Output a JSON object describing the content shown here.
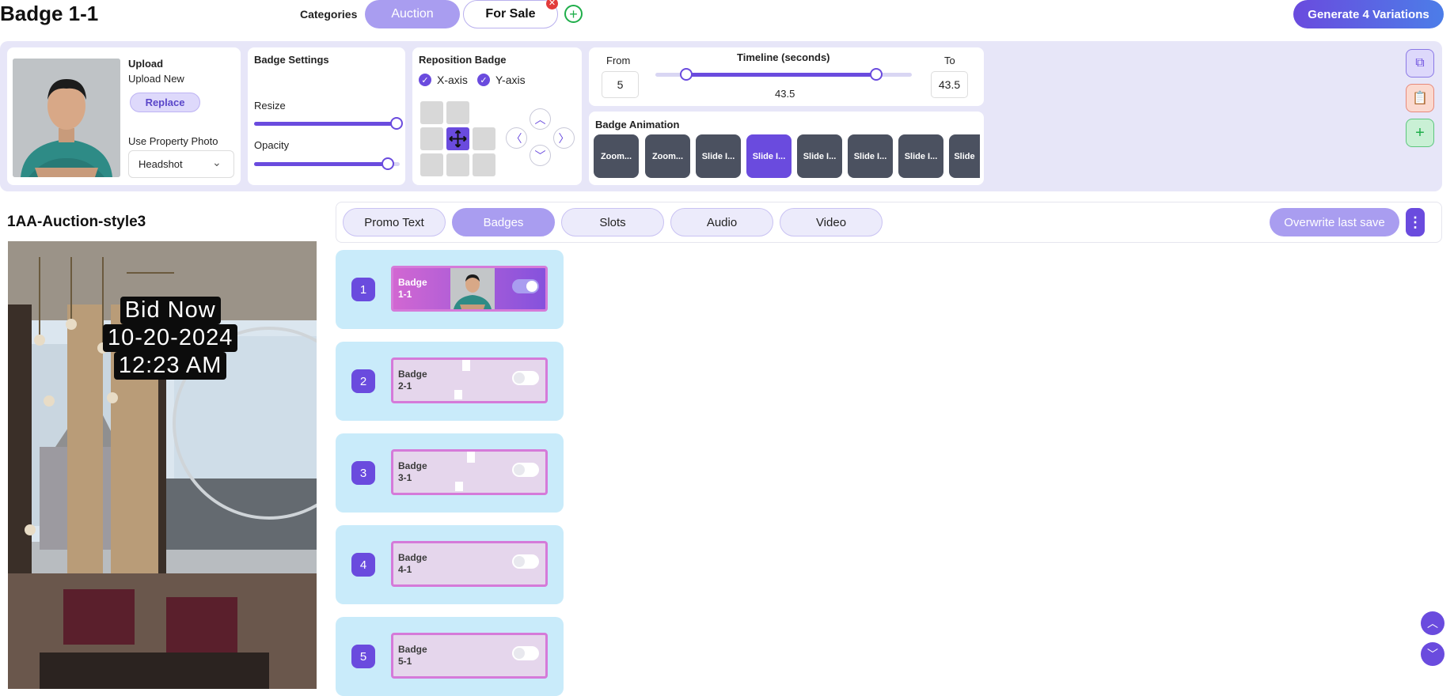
{
  "header": {
    "title": "Badge 1-1",
    "categories_label": "Categories",
    "tabs": [
      {
        "label": "Auction",
        "active": true
      },
      {
        "label": "For Sale",
        "active": false
      }
    ],
    "generate_label": "Generate 4 Variations"
  },
  "upload": {
    "heading": "Upload",
    "subheading": "Upload New",
    "replace_label": "Replace",
    "property_photo_label": "Use Property Photo",
    "property_photo_value": "Headshot"
  },
  "badge_settings": {
    "heading": "Badge Settings",
    "resize_label": "Resize",
    "resize_value": 1.0,
    "opacity_label": "Opacity",
    "opacity_value": 0.92
  },
  "reposition": {
    "heading": "Reposition Badge",
    "x_axis_label": "X-axis",
    "y_axis_label": "Y-axis",
    "x_axis_checked": true,
    "y_axis_checked": true
  },
  "timeline": {
    "heading": "Timeline (seconds)",
    "from_label": "From",
    "from_value": "5",
    "to_label": "To",
    "to_value": "43.5",
    "current_value": "43.5"
  },
  "animation": {
    "heading": "Badge Animation",
    "options": [
      {
        "label": "Zoom...",
        "active": false
      },
      {
        "label": "Zoom...",
        "active": false
      },
      {
        "label": "Slide I...",
        "active": false
      },
      {
        "label": "Slide I...",
        "active": true
      },
      {
        "label": "Slide I...",
        "active": false
      },
      {
        "label": "Slide I...",
        "active": false
      },
      {
        "label": "Slide I...",
        "active": false
      },
      {
        "label": "Slide",
        "active": false
      }
    ]
  },
  "preview": {
    "style_name": "1AA-Auction-style3",
    "overlay_lines": [
      "Bid Now",
      "10-20-2024",
      "12:23 AM"
    ]
  },
  "content_tabs": [
    {
      "label": "Promo Text",
      "active": false
    },
    {
      "label": "Badges",
      "active": true
    },
    {
      "label": "Slots",
      "active": false
    },
    {
      "label": "Audio",
      "active": false
    },
    {
      "label": "Video",
      "active": false
    }
  ],
  "overwrite_label": "Overwrite last save",
  "badges": [
    {
      "number": "1",
      "line1": "Badge",
      "line2": "1-1",
      "enabled": true
    },
    {
      "number": "2",
      "line1": "Badge",
      "line2": "2-1",
      "enabled": false
    },
    {
      "number": "3",
      "line1": "Badge",
      "line2": "3-1",
      "enabled": false
    },
    {
      "number": "4",
      "line1": "Badge",
      "line2": "4-1",
      "enabled": false
    },
    {
      "number": "5",
      "line1": "Badge",
      "line2": "5-1",
      "enabled": false
    }
  ],
  "icons": {
    "close": "close-icon",
    "add": "plus-icon",
    "chevron": "chevron-down-icon",
    "move": "move-icon",
    "copy": "copy-icon",
    "paste": "clipboard-icon",
    "more": "more-vertical-icon",
    "scroll_up": "chevron-up-icon",
    "scroll_down": "chevron-down-icon"
  },
  "colors": {
    "accent": "#6a4bde",
    "accent_light": "#a99df0",
    "panel_bg": "#e7e6f8",
    "badge_row_bg": "#c9ebfa",
    "badge_card_border": "#d57ad9",
    "success": "#1fae4a",
    "danger": "#e23b3b"
  }
}
